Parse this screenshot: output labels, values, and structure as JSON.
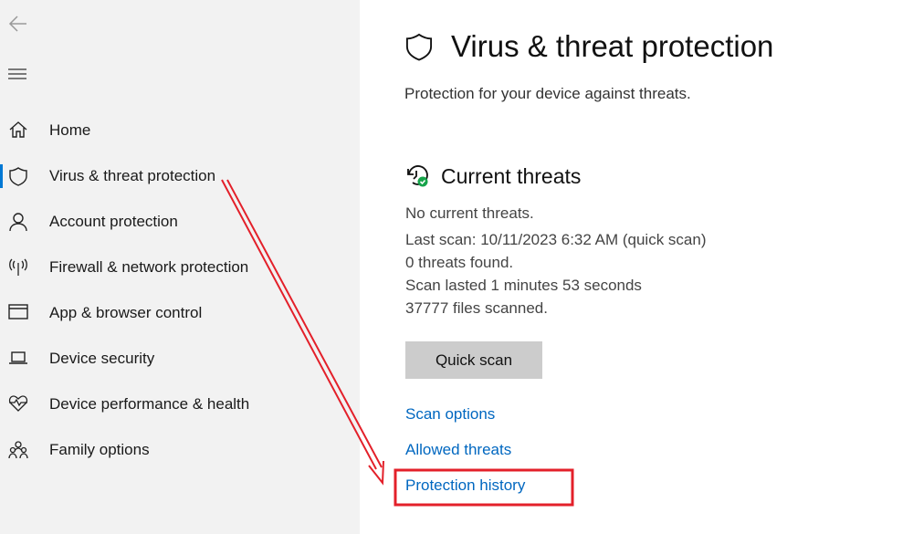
{
  "sidebar": {
    "items": [
      {
        "label": "Home",
        "icon": "home-icon"
      },
      {
        "label": "Virus & threat protection",
        "icon": "shield-icon",
        "selected": true
      },
      {
        "label": "Account protection",
        "icon": "person-icon"
      },
      {
        "label": "Firewall & network protection",
        "icon": "antenna-icon"
      },
      {
        "label": "App & browser control",
        "icon": "browser-window-icon"
      },
      {
        "label": "Device security",
        "icon": "laptop-icon"
      },
      {
        "label": "Device performance & health",
        "icon": "heart-icon"
      },
      {
        "label": "Family options",
        "icon": "family-icon"
      }
    ]
  },
  "main": {
    "title": "Virus & threat protection",
    "subtitle": "Protection for your device against threats.",
    "current_threats": {
      "heading": "Current threats",
      "status": "No current threats.",
      "last_scan": "Last scan: 10/11/2023 6:32 AM (quick scan)",
      "threats_found": "0 threats found.",
      "duration": "Scan lasted 1 minutes 53 seconds",
      "files": "37777 files scanned."
    },
    "quick_scan": "Quick scan",
    "links": [
      "Scan options",
      "Allowed threats",
      "Protection history"
    ]
  },
  "colors": {
    "accent": "#0078d4",
    "link": "#0067c0",
    "annotation": "#e3202a",
    "sidebar_bg": "#f2f2f2"
  }
}
